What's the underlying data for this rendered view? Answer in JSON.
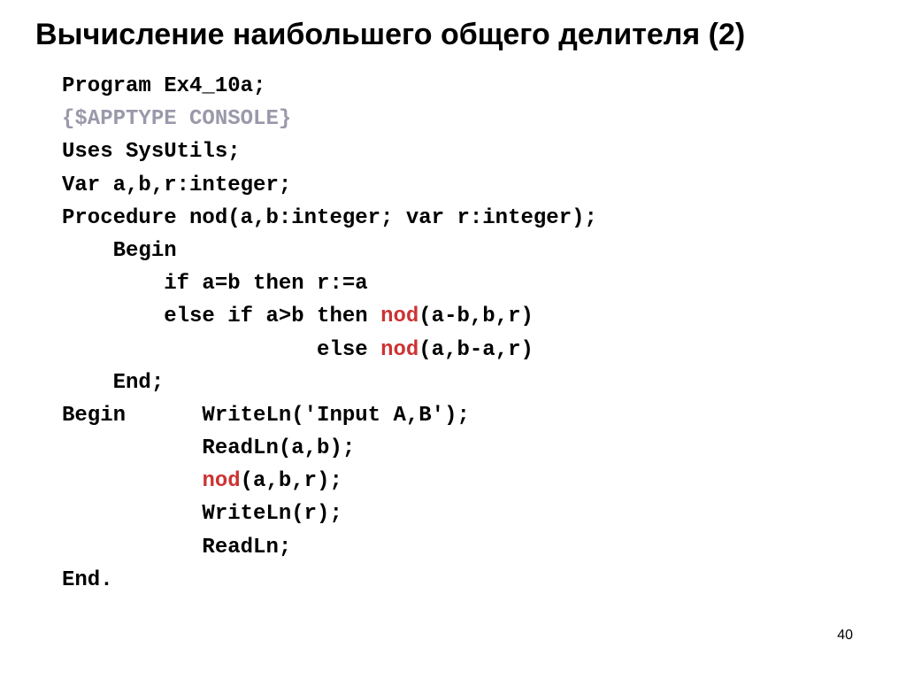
{
  "title": "Вычисление наибольшего общего делителя (2)",
  "code": {
    "line1": "Program Ex4_10a;",
    "line2": "{$APPTYPE CONSOLE}",
    "line3": "Uses SysUtils;",
    "line4": "Var a,b,r:integer;",
    "line5": "Procedure nod(a,b:integer; var r:integer);",
    "line6": "    Begin",
    "line7": "        if a=b then r:=a",
    "line8a": "        else if a>b then ",
    "line8b": "nod",
    "line8c": "(a-b,b,r)",
    "line9a": "                    else ",
    "line9b": "nod",
    "line9c": "(a,b-a,r)",
    "line10": "    End;",
    "line11": "Begin      WriteLn('Input A,B');",
    "line12": "           ReadLn(a,b);",
    "line13a": "           ",
    "line13b": "nod",
    "line13c": "(a,b,r);",
    "line14": "           WriteLn(r);",
    "line15": "           ReadLn;",
    "line16": "End."
  },
  "pageNumber": "40"
}
